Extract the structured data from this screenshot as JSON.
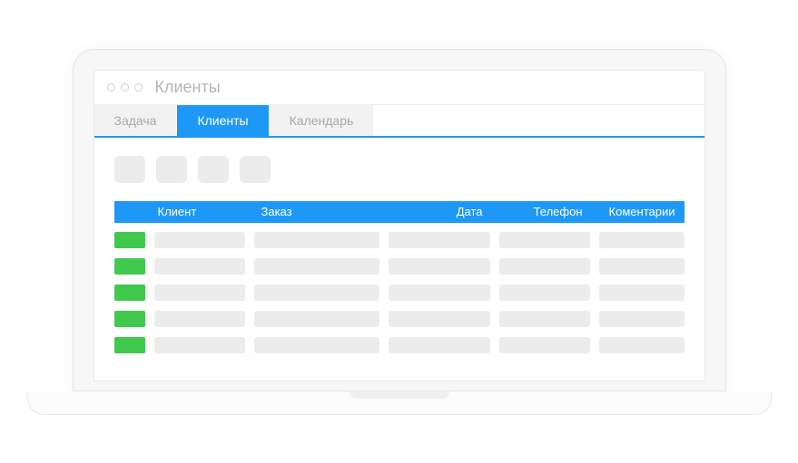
{
  "window": {
    "title": "Клиенты"
  },
  "tabs": [
    {
      "label": "Задача",
      "active": false
    },
    {
      "label": "Клиенты",
      "active": true
    },
    {
      "label": "Календарь",
      "active": false
    }
  ],
  "toolbar": {
    "buttons": [
      {
        "name": "tool-1"
      },
      {
        "name": "tool-2"
      },
      {
        "name": "tool-3"
      },
      {
        "name": "tool-4"
      }
    ]
  },
  "table": {
    "columns": {
      "status": "",
      "client": "Клиент",
      "order": "Заказ",
      "date": "Дата",
      "phone": "Телефон",
      "comment": "Коментарии"
    },
    "rows": [
      {
        "status": "green",
        "client": "",
        "order": "",
        "date": "",
        "phone": "",
        "comment": ""
      },
      {
        "status": "green",
        "client": "",
        "order": "",
        "date": "",
        "phone": "",
        "comment": ""
      },
      {
        "status": "green",
        "client": "",
        "order": "",
        "date": "",
        "phone": "",
        "comment": ""
      },
      {
        "status": "green",
        "client": "",
        "order": "",
        "date": "",
        "phone": "",
        "comment": ""
      },
      {
        "status": "green",
        "client": "",
        "order": "",
        "date": "",
        "phone": "",
        "comment": ""
      }
    ]
  },
  "colors": {
    "accent": "#1e98f7",
    "status_green": "#41c94e",
    "placeholder": "#ececec"
  }
}
